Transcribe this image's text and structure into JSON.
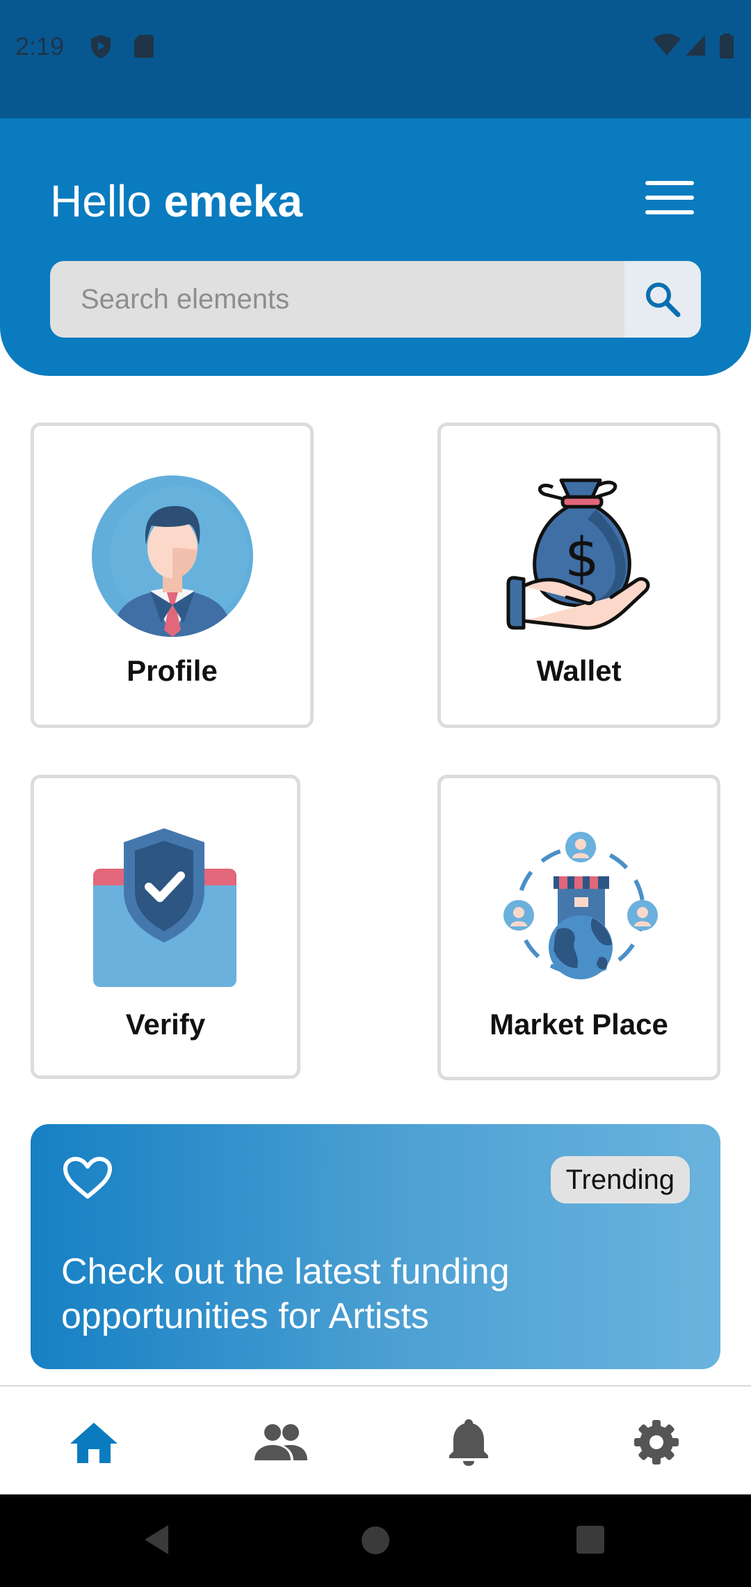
{
  "status_bar": {
    "time": "2:19"
  },
  "header": {
    "greeting": "Hello",
    "username": "emeka",
    "menu_icon": "hamburger-menu-icon"
  },
  "search": {
    "placeholder": "Search elements",
    "icon": "search-icon"
  },
  "cards": [
    {
      "label": "Profile",
      "icon": "businessman-avatar-icon"
    },
    {
      "label": "Wallet",
      "icon": "money-bag-hand-icon"
    },
    {
      "label": "Verify",
      "icon": "shield-check-icon"
    },
    {
      "label": "Market Place",
      "icon": "marketplace-globe-icon"
    }
  ],
  "banner": {
    "badge": "Trending",
    "text": "Check out the latest funding opportunities for Artists",
    "icon": "heart-outline-icon"
  },
  "bottom_nav": [
    {
      "icon": "home-icon",
      "active": true
    },
    {
      "icon": "people-icon",
      "active": false
    },
    {
      "icon": "bell-icon",
      "active": false
    },
    {
      "icon": "gear-icon",
      "active": false
    }
  ],
  "colors": {
    "primary": "#0a7bbf",
    "status_bar": "#075891",
    "nav_active": "#0a7bbf",
    "nav_inactive": "#555555"
  }
}
